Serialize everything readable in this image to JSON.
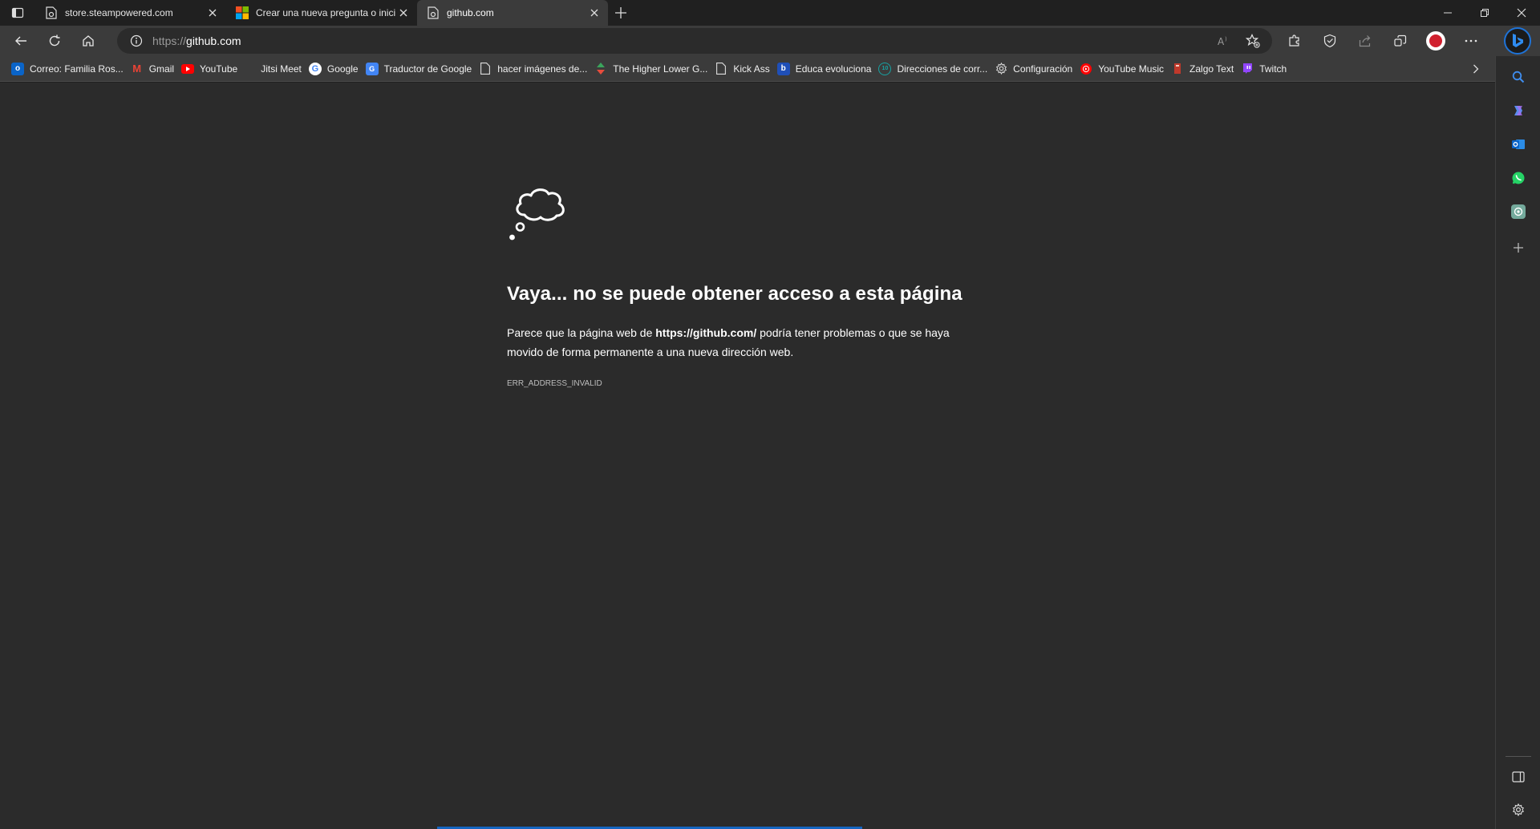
{
  "tabs": [
    {
      "title": "store.steampowered.com",
      "icon": "steam-icon"
    },
    {
      "title": "Crear una nueva pregunta o inici",
      "icon": "microsoft-icon"
    },
    {
      "title": "github.com",
      "icon": "page-icon",
      "active": true
    }
  ],
  "address": {
    "scheme": "https://",
    "host": "github.com"
  },
  "bookmarks": [
    {
      "label": "Correo: Familia Ros...",
      "icon": "outlook-icon",
      "color": "#0a64c8"
    },
    {
      "label": "Gmail",
      "icon": "gmail-icon",
      "color": "#ea4335"
    },
    {
      "label": "YouTube",
      "icon": "youtube-icon",
      "color": "#ff0000"
    },
    {
      "label": "Jitsi Meet",
      "icon": "blank-icon",
      "color": "#3b3b3b"
    },
    {
      "label": "Google",
      "icon": "google-icon",
      "color": "#ffffff"
    },
    {
      "label": "Traductor de Google",
      "icon": "translate-icon",
      "color": "#4285f4"
    },
    {
      "label": "hacer imágenes de...",
      "icon": "page-icon",
      "color": "#3b3b3b"
    },
    {
      "label": "The Higher Lower G...",
      "icon": "higherlower-icon",
      "color": "#3ba55c"
    },
    {
      "label": "Kick Ass",
      "icon": "page-icon",
      "color": "#3b3b3b"
    },
    {
      "label": "Educa evoluciona",
      "icon": "educa-icon",
      "color": "#1f4fb8"
    },
    {
      "label": "Direcciones de corr...",
      "icon": "directions-icon",
      "color": "#17a2a2"
    },
    {
      "label": "Configuración",
      "icon": "gear-icon",
      "color": "#3b3b3b"
    },
    {
      "label": "YouTube Music",
      "icon": "youtube-music-icon",
      "color": "#ff0000"
    },
    {
      "label": "Zalgo Text",
      "icon": "zalgo-icon",
      "color": "#c0392b"
    },
    {
      "label": "Twitch",
      "icon": "twitch-icon",
      "color": "#9146ff"
    }
  ],
  "error": {
    "title": "Vaya... no se puede obtener acceso a esta página",
    "body_before": "Parece que la página web de ",
    "body_url": "https://github.com/",
    "body_after": " podría tener problemas o que se haya movido de forma permanente a una nueva dirección web.",
    "code": "ERR_ADDRESS_INVALID"
  },
  "colors": {
    "bing": "#1e73d8",
    "whatsapp": "#25d366",
    "outlook": "#0a64c8",
    "copilot": "#5b8def"
  }
}
